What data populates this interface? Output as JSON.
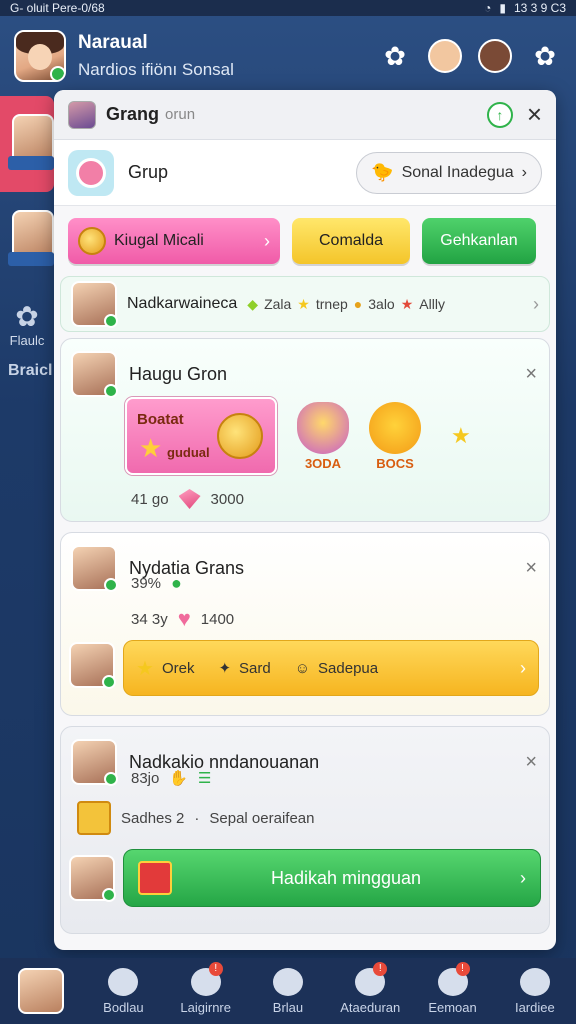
{
  "status": {
    "left": "G- oluit  Pere-0/68",
    "right": "13 3 9 C3"
  },
  "header": {
    "name": "Naraual",
    "subtitle": "Nardios ifiönı Sonsal"
  },
  "side": {
    "item_label_1": "Flaulc",
    "item_label_2": "Braicl"
  },
  "panel": {
    "title": "Grang",
    "title_sub": "orun",
    "grup": {
      "label": "Grup",
      "button_label": "Sonal Inadegua"
    },
    "buttons": {
      "pink": "Kiugal Micali",
      "yellow": "Comalda",
      "green": "Gehkanlan"
    },
    "strip": {
      "name": "Nadkarwaineca",
      "a": "Zala",
      "b": "trnep",
      "c": "3alo",
      "d": "Allly"
    },
    "card1": {
      "title": "Haugu Gron",
      "reward_text_1": "Boatat",
      "reward_text_2": "gudual",
      "badge1": "3ODA",
      "badge2": "BOCS",
      "meta_left": "41 go",
      "meta_right": "3000"
    },
    "card2": {
      "title": "Nydatia Grans",
      "line1": "39%",
      "line2_left": "34 3y",
      "line2_right": "1400",
      "bar": {
        "a": "Orek",
        "b": "Sard",
        "c": "Sadepua"
      }
    },
    "card3": {
      "title": "Nadkakio nndanouanan",
      "line1": "83jo",
      "line2_a": "Sadhes 2",
      "line2_b": "Sepal oeraifean",
      "green_bar": "Hadikah mingguan"
    }
  },
  "nav": {
    "items": [
      "Bodlau",
      "Laigirnre",
      "Brlau",
      "Ataeduran",
      "Eemoan",
      "Iardiee"
    ]
  }
}
